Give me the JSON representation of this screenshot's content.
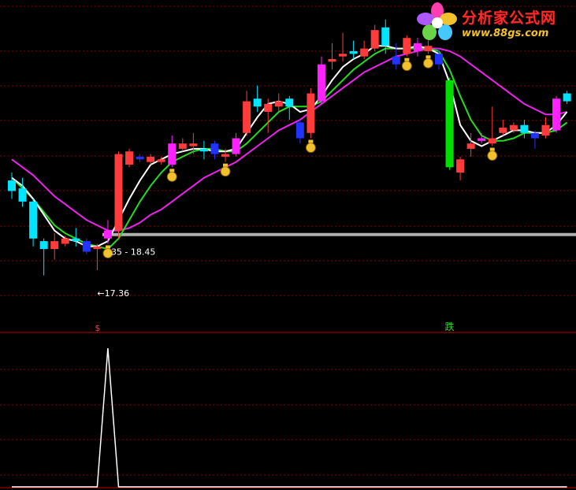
{
  "watermark": {
    "title": "分析家公式网",
    "url": "www.88gs.com",
    "icon": "flower-logo-icon",
    "title_color": "#ff2a2a",
    "url_color": "#f2c12e"
  },
  "colors": {
    "background": "#000000",
    "grid": "#8b0000",
    "up_candle": "#ff3b3b",
    "down_candle": "#00e5ff",
    "magenta_candle": "#ff22ff",
    "blue_candle": "#2233ff",
    "signal_candle": "#00dd00",
    "ma_fast": "#ffffff",
    "ma_mid": "#22dd22",
    "ma_slow": "#ee22ee",
    "support_line": "#b0b0b0",
    "indicator_line": "#ffffff",
    "marker_icon": "#f2c12e"
  },
  "main_labels": {
    "range_label": "35 - 18.45",
    "low_label": "←17.36",
    "buy_marker": "$",
    "sell_marker": "跌"
  },
  "chart_data": {
    "type": "candlestick",
    "price_range": [
      15.1,
      27.4
    ],
    "support_level": 18.75,
    "candles": [
      {
        "o": 20.8,
        "c": 20.4,
        "h": 21.1,
        "l": 20.1,
        "t": "down"
      },
      {
        "o": 20.5,
        "c": 20.0,
        "h": 20.9,
        "l": 19.8,
        "t": "down"
      },
      {
        "o": 20.0,
        "c": 18.6,
        "h": 20.1,
        "l": 18.3,
        "t": "down"
      },
      {
        "o": 18.5,
        "c": 18.2,
        "h": 18.6,
        "l": 17.2,
        "t": "down"
      },
      {
        "o": 18.2,
        "c": 18.5,
        "h": 18.8,
        "l": 17.8,
        "t": "up"
      },
      {
        "o": 18.4,
        "c": 18.6,
        "h": 18.7,
        "l": 18.3,
        "t": "up"
      },
      {
        "o": 18.5,
        "c": 18.6,
        "h": 19.0,
        "l": 18.3,
        "t": "down"
      },
      {
        "o": 18.5,
        "c": 18.1,
        "h": 18.6,
        "l": 18.0,
        "t": "blue"
      },
      {
        "o": 18.2,
        "c": 18.3,
        "h": 18.4,
        "l": 17.4,
        "t": "up"
      },
      {
        "o": 18.6,
        "c": 18.9,
        "h": 19.3,
        "l": 18.4,
        "t": "magenta"
      },
      {
        "o": 18.9,
        "c": 21.8,
        "h": 21.9,
        "l": 18.6,
        "t": "up"
      },
      {
        "o": 21.4,
        "c": 21.9,
        "h": 22.0,
        "l": 21.3,
        "t": "up"
      },
      {
        "o": 21.6,
        "c": 21.7,
        "h": 21.8,
        "l": 21.5,
        "t": "blue"
      },
      {
        "o": 21.5,
        "c": 21.7,
        "h": 21.8,
        "l": 21.4,
        "t": "up"
      },
      {
        "o": 21.5,
        "c": 21.6,
        "h": 21.7,
        "l": 21.4,
        "t": "up"
      },
      {
        "o": 21.4,
        "c": 22.2,
        "h": 22.5,
        "l": 21.3,
        "t": "magenta"
      },
      {
        "o": 22.0,
        "c": 22.2,
        "h": 22.4,
        "l": 21.9,
        "t": "up"
      },
      {
        "o": 22.2,
        "c": 22.1,
        "h": 22.6,
        "l": 21.8,
        "t": "up"
      },
      {
        "o": 22.0,
        "c": 21.9,
        "h": 22.3,
        "l": 21.6,
        "t": "down"
      },
      {
        "o": 22.2,
        "c": 21.8,
        "h": 22.3,
        "l": 21.6,
        "t": "blue"
      },
      {
        "o": 21.7,
        "c": 21.8,
        "h": 22.0,
        "l": 21.5,
        "t": "up"
      },
      {
        "o": 21.8,
        "c": 22.4,
        "h": 22.6,
        "l": 21.7,
        "t": "magenta"
      },
      {
        "o": 22.6,
        "c": 23.8,
        "h": 24.2,
        "l": 22.5,
        "t": "up"
      },
      {
        "o": 23.6,
        "c": 23.9,
        "h": 24.4,
        "l": 23.4,
        "t": "down"
      },
      {
        "o": 23.4,
        "c": 23.7,
        "h": 23.9,
        "l": 22.6,
        "t": "up"
      },
      {
        "o": 23.6,
        "c": 23.8,
        "h": 24.1,
        "l": 23.4,
        "t": "up"
      },
      {
        "o": 23.9,
        "c": 23.6,
        "h": 24.0,
        "l": 23.1,
        "t": "down"
      },
      {
        "o": 23.0,
        "c": 22.4,
        "h": 23.1,
        "l": 22.2,
        "t": "blue"
      },
      {
        "o": 22.6,
        "c": 24.1,
        "h": 24.3,
        "l": 22.4,
        "t": "up"
      },
      {
        "o": 23.8,
        "c": 25.2,
        "h": 25.5,
        "l": 23.7,
        "t": "magenta"
      },
      {
        "o": 25.3,
        "c": 25.4,
        "h": 26.0,
        "l": 25.0,
        "t": "up"
      },
      {
        "o": 25.5,
        "c": 25.6,
        "h": 26.4,
        "l": 25.3,
        "t": "up"
      },
      {
        "o": 25.6,
        "c": 25.7,
        "h": 26.1,
        "l": 25.4,
        "t": "down"
      },
      {
        "o": 25.5,
        "c": 25.8,
        "h": 26.1,
        "l": 25.4,
        "t": "up"
      },
      {
        "o": 25.8,
        "c": 26.5,
        "h": 26.7,
        "l": 25.7,
        "t": "up"
      },
      {
        "o": 26.6,
        "c": 25.9,
        "h": 26.9,
        "l": 25.6,
        "t": "down"
      },
      {
        "o": 25.5,
        "c": 25.2,
        "h": 26.0,
        "l": 25.0,
        "t": "blue"
      },
      {
        "o": 25.6,
        "c": 26.2,
        "h": 26.3,
        "l": 25.5,
        "t": "up"
      },
      {
        "o": 26.0,
        "c": 25.7,
        "h": 26.2,
        "l": 25.5,
        "t": "magenta"
      },
      {
        "o": 25.7,
        "c": 25.9,
        "h": 26.1,
        "l": 25.6,
        "t": "up"
      },
      {
        "o": 25.6,
        "c": 25.2,
        "h": 25.8,
        "l": 25.0,
        "t": "blue"
      },
      {
        "o": 24.6,
        "c": 21.3,
        "h": 24.7,
        "l": 21.2,
        "t": "signal"
      },
      {
        "o": 21.1,
        "c": 21.6,
        "h": 21.7,
        "l": 20.8,
        "t": "up"
      },
      {
        "o": 22.0,
        "c": 22.2,
        "h": 22.6,
        "l": 21.7,
        "t": "up"
      },
      {
        "o": 22.4,
        "c": 22.3,
        "h": 22.6,
        "l": 22.2,
        "t": "magenta"
      },
      {
        "o": 22.2,
        "c": 22.4,
        "h": 23.6,
        "l": 22.1,
        "t": "up"
      },
      {
        "o": 22.6,
        "c": 22.8,
        "h": 23.1,
        "l": 22.5,
        "t": "up"
      },
      {
        "o": 22.7,
        "c": 22.9,
        "h": 23.0,
        "l": 22.6,
        "t": "up"
      },
      {
        "o": 22.9,
        "c": 22.6,
        "h": 23.1,
        "l": 22.4,
        "t": "down"
      },
      {
        "o": 22.6,
        "c": 22.4,
        "h": 22.7,
        "l": 22.0,
        "t": "blue"
      },
      {
        "o": 22.9,
        "c": 22.5,
        "h": 23.2,
        "l": 22.4,
        "t": "up"
      },
      {
        "o": 22.7,
        "c": 23.9,
        "h": 24.0,
        "l": 22.6,
        "t": "magenta"
      },
      {
        "o": 23.8,
        "c": 24.1,
        "h": 24.2,
        "l": 23.7,
        "t": "down"
      }
    ],
    "ma_fast": [
      20.9,
      20.6,
      20.1,
      19.5,
      18.9,
      18.6,
      18.5,
      18.3,
      18.3,
      18.5,
      19.3,
      20.1,
      20.8,
      21.4,
      21.6,
      21.8,
      21.9,
      22.0,
      22.0,
      21.9,
      21.9,
      22.0,
      22.6,
      23.2,
      23.7,
      23.8,
      23.7,
      23.4,
      23.5,
      24.0,
      24.6,
      25.1,
      25.4,
      25.6,
      25.9,
      25.9,
      25.8,
      25.8,
      25.9,
      25.8,
      25.6,
      24.5,
      22.9,
      22.3,
      22.1,
      22.3,
      22.5,
      22.7,
      22.7,
      22.6,
      22.6,
      22.9,
      23.4
    ],
    "ma_mid": [
      20.9,
      20.5,
      20.1,
      19.6,
      19.1,
      18.8,
      18.6,
      18.4,
      18.3,
      18.2,
      18.6,
      19.3,
      20.0,
      20.6,
      21.1,
      21.5,
      21.7,
      21.9,
      22.0,
      22.0,
      21.9,
      21.9,
      22.2,
      22.6,
      23.0,
      23.4,
      23.6,
      23.6,
      23.6,
      23.8,
      24.2,
      24.6,
      25.0,
      25.3,
      25.6,
      25.8,
      25.8,
      25.8,
      25.8,
      25.8,
      25.7,
      25.0,
      24.0,
      23.1,
      22.5,
      22.3,
      22.3,
      22.4,
      22.6,
      22.6,
      22.6,
      22.7,
      23.0
    ],
    "ma_slow": [
      21.6,
      21.3,
      21.0,
      20.6,
      20.2,
      19.9,
      19.6,
      19.3,
      19.1,
      18.9,
      18.9,
      19.0,
      19.2,
      19.5,
      19.7,
      20.0,
      20.3,
      20.6,
      20.9,
      21.1,
      21.3,
      21.5,
      21.8,
      22.1,
      22.4,
      22.7,
      22.9,
      23.1,
      23.4,
      23.7,
      24.0,
      24.3,
      24.6,
      24.9,
      25.1,
      25.3,
      25.5,
      25.6,
      25.7,
      25.8,
      25.8,
      25.7,
      25.5,
      25.2,
      24.9,
      24.6,
      24.3,
      24.0,
      23.7,
      23.5,
      23.3,
      23.3,
      23.4
    ],
    "marker_indices": [
      9,
      15,
      20,
      28,
      37,
      39,
      45
    ],
    "buy_marker_index": 8,
    "sell_marker_index": 41,
    "range_label_index": 9,
    "low_label_index": 8,
    "indicator": {
      "type": "line",
      "x_index": [
        0,
        7,
        8,
        9,
        10,
        52
      ],
      "values": [
        0,
        0,
        0,
        1,
        0,
        0
      ],
      "ylim": [
        0,
        1
      ]
    }
  }
}
